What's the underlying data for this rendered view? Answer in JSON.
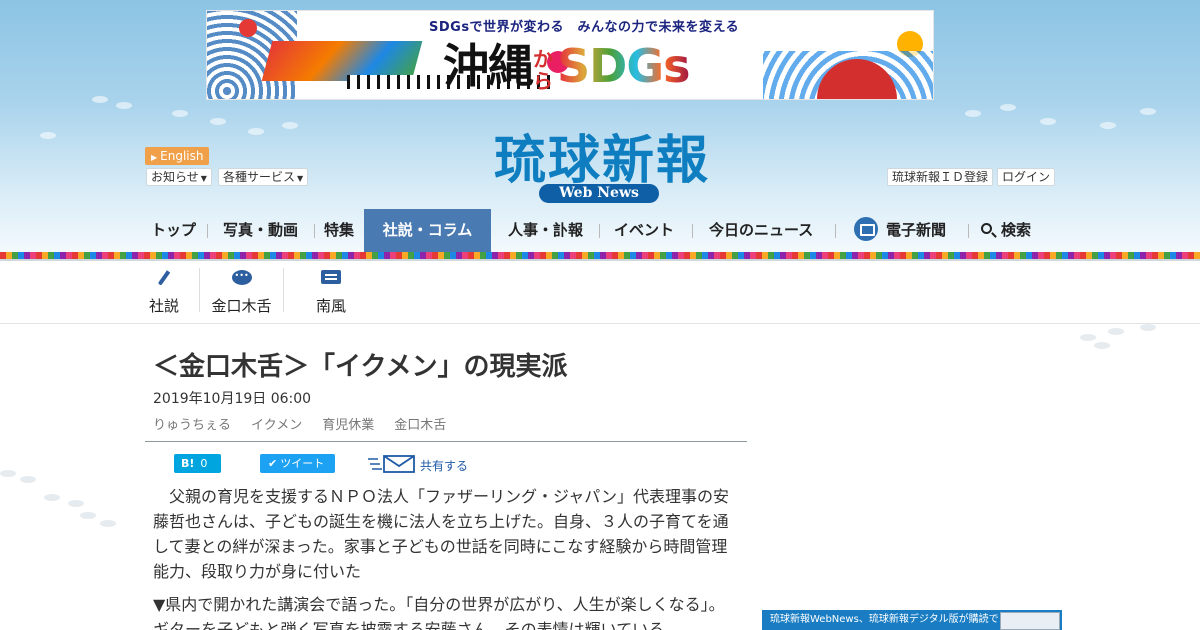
{
  "banner": {
    "tagline": "SDGsで世界が変わる　みんなの力で未来を変える",
    "title_prefix": "沖縄",
    "title_kara": "から",
    "title_suffix": "SDGs"
  },
  "header": {
    "english_label": "English",
    "oshirase_label": "お知らせ",
    "services_label": "各種サービス",
    "logo_text": "琉球新報",
    "logo_sub": "Web News",
    "id_register_label": "琉球新報ＩＤ登録",
    "login_label": "ログイン"
  },
  "nav": {
    "items": [
      {
        "label": "トップ"
      },
      {
        "label": "写真・動画"
      },
      {
        "label": "特集"
      },
      {
        "label": "社説・コラム",
        "active": true
      },
      {
        "label": "人事・訃報"
      },
      {
        "label": "イベント"
      },
      {
        "label": "今日のニュース"
      },
      {
        "label": "電子新聞"
      },
      {
        "label": "検索"
      }
    ]
  },
  "subnav": {
    "items": [
      {
        "label": "社説",
        "icon": "pen-icon"
      },
      {
        "label": "金口木舌",
        "icon": "speech-bubble-icon"
      },
      {
        "label": "南風",
        "icon": "message-icon"
      }
    ]
  },
  "article": {
    "title": "＜金口木舌＞「イクメン」の現実派",
    "date": "2019年10月19日 06:00",
    "tags": [
      "りゅうちぇる",
      "イクメン",
      "育児休業",
      "金口木舌"
    ],
    "hatebu_label": "B!",
    "hatebu_count": "0",
    "tweet_label": "ツイート",
    "share_label": "共有する",
    "paragraphs": [
      "　父親の育児を支援するＮＰＯ法人「ファザーリング・ジャパン」代表理事の安藤哲也さんは、子どもの誕生を機に法人を立ち上げた。自身、３人の子育てを通して妻との絆が深まった。家事と子どもの世話を同時にこなす経験から時間管理能力、段取り力が身に付いた",
      "▼県内で開かれた講演会で語った。「自分の世界が広がり、人生が楽しくなる」。ギターを子どもと弾く写真を披露する安藤さん。その表情は輝いている"
    ]
  },
  "side_ad": {
    "text": "琉球新報WebNews、琉球新報デジタル版が購読できる"
  },
  "colors": {
    "nav_active": "#4a7ab2",
    "logo_blue": "#0e7ec0",
    "english_orange": "#f0a048",
    "hatebu_blue": "#00a4de",
    "twitter_blue": "#1da1f2"
  }
}
